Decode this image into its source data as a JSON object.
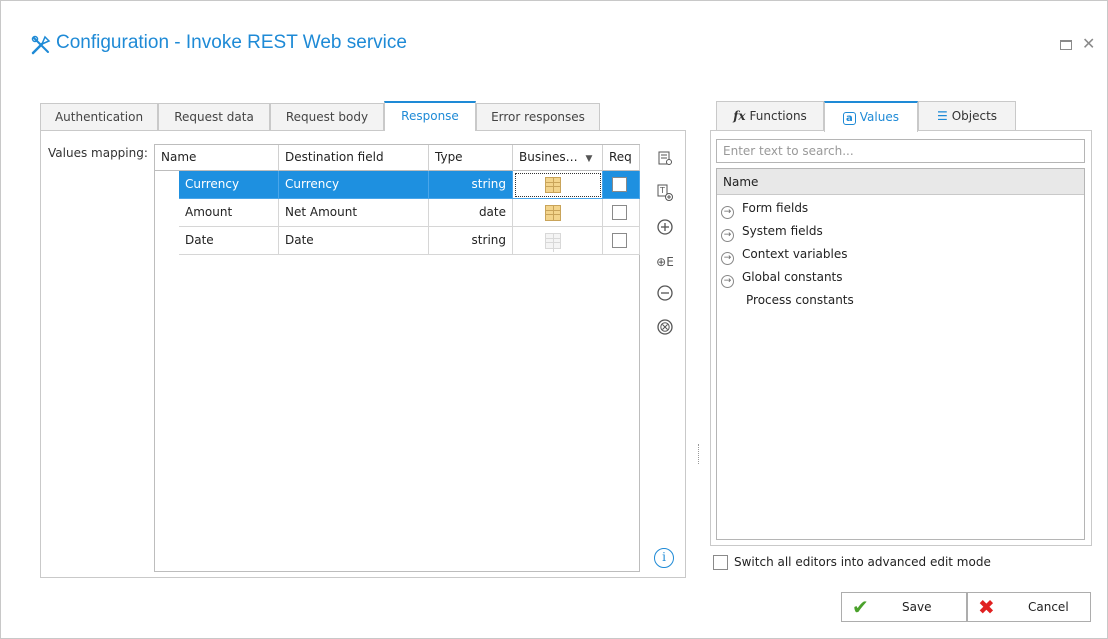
{
  "dialog": {
    "title": "Configuration - Invoke REST Web service",
    "icon": "tools-icon"
  },
  "tabs": [
    "Authentication",
    "Request data",
    "Request body",
    "Response",
    "Error responses"
  ],
  "active_tab": "Response",
  "values_mapping": {
    "label": "Values mapping:",
    "columns": [
      "Name",
      "Destination field",
      "Type",
      "Busines…",
      "Req"
    ],
    "rows": [
      {
        "name": "Currency",
        "destination": "Currency",
        "type": "string",
        "business": true,
        "req": false,
        "selected": true
      },
      {
        "name": "Amount",
        "destination": "Net Amount",
        "type": "date",
        "business": true,
        "req": false,
        "selected": false
      },
      {
        "name": "Date",
        "destination": "Date",
        "type": "string",
        "business": false,
        "req": false,
        "selected": false
      }
    ],
    "selection_color": "#1e90e0"
  },
  "side_tools": [
    "browse-icon",
    "add-text-icon",
    "add-icon",
    "add-expression-icon",
    "remove-icon",
    "remove-all-icon",
    "info-icon"
  ],
  "right_tabs": [
    {
      "label": "Functions",
      "glyph": "fx"
    },
    {
      "label": "Values",
      "glyph": "a"
    },
    {
      "label": "Objects",
      "glyph": "≡"
    }
  ],
  "active_right_tab": "Values",
  "search": {
    "placeholder": "Enter text to search...",
    "value": ""
  },
  "tree": {
    "header": "Name",
    "items": [
      {
        "label": "Form fields",
        "expandable": true
      },
      {
        "label": "System fields",
        "expandable": true
      },
      {
        "label": "Context variables",
        "expandable": true
      },
      {
        "label": "Global constants",
        "expandable": true
      },
      {
        "label": "Process constants",
        "expandable": false
      }
    ]
  },
  "advanced_mode": {
    "label": "Switch all editors into advanced edit mode",
    "checked": false
  },
  "buttons": {
    "save": "Save",
    "cancel": "Cancel"
  },
  "colors": {
    "accent": "#1e8ad6",
    "save_icon": "#4aa12b",
    "cancel_icon": "#e02020"
  }
}
